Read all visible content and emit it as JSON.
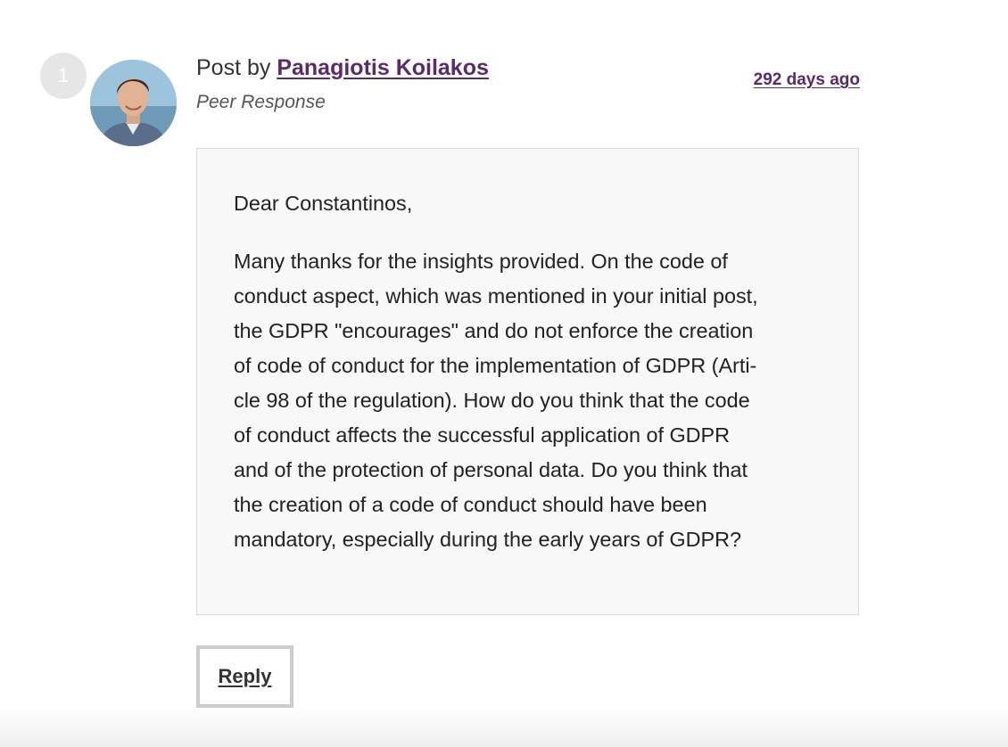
{
  "post": {
    "number": "1",
    "header_prefix": "Post by",
    "author": "Panagiotis Koilakos",
    "response_type": "Peer Response",
    "timestamp": "292 days ago",
    "greeting": "Dear Constantinos,",
    "body_lines": [
      "Many thanks for the insights provided. On the code of",
      "conduct aspect, which was mentioned in your initial post,",
      "the GDPR \"encourages\" and do not enforce the creation",
      "of code of conduct for the implementation of GDPR (Arti-",
      "cle 98 of the regulation). How do you think that the code",
      "of conduct affects the successful application of GDPR",
      "and of the protection of personal data. Do you think that",
      "the creation of a code of conduct should have been",
      "mandatory, especially during the early years of GDPR?"
    ]
  },
  "actions": {
    "reply_label": "Reply"
  },
  "colors": {
    "link": "#5b2a6e",
    "box_background": "#f8f8f8",
    "badge": "#e6e6e6"
  }
}
